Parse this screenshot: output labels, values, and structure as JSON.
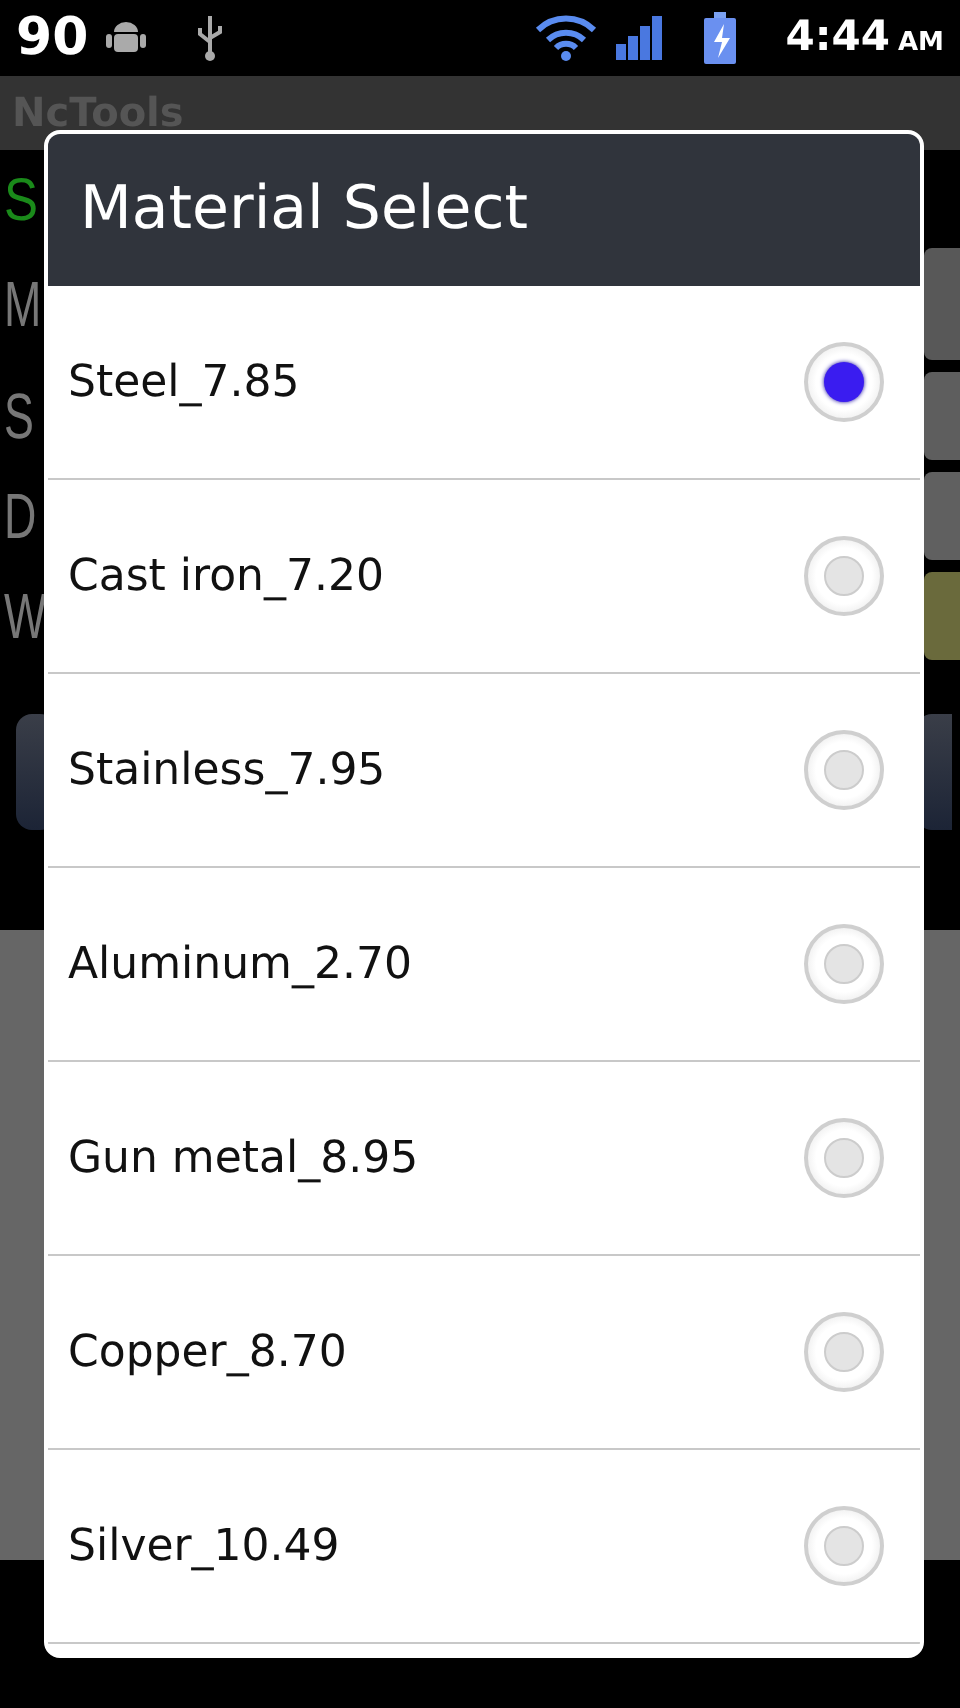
{
  "status_bar": {
    "notification_count": "90",
    "time": "4:44",
    "meridiem": "AM"
  },
  "app": {
    "title": "NcTools",
    "heading": "S",
    "labels": [
      "M",
      "S",
      "D",
      "W"
    ]
  },
  "dialog": {
    "title": "Material Select",
    "options": [
      {
        "label": "Steel_7.85",
        "selected": true
      },
      {
        "label": "Cast iron_7.20",
        "selected": false
      },
      {
        "label": "Stainless_7.95",
        "selected": false
      },
      {
        "label": "Aluminum_2.70",
        "selected": false
      },
      {
        "label": "Gun metal_8.95",
        "selected": false
      },
      {
        "label": "Copper_8.70",
        "selected": false
      },
      {
        "label": "Silver_10.49",
        "selected": false
      }
    ]
  }
}
